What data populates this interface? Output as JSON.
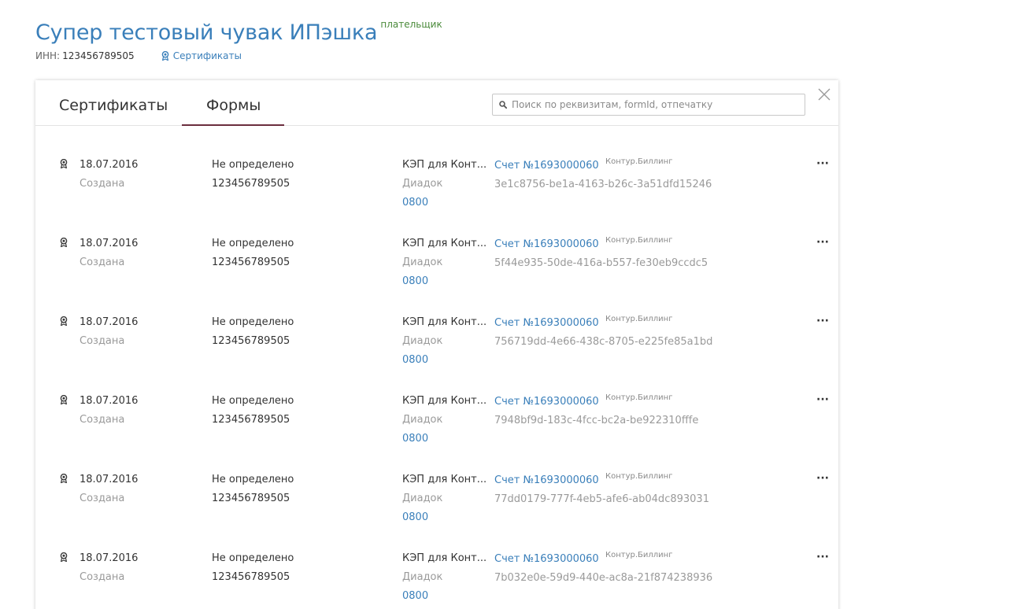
{
  "header": {
    "title": "Супер тестовый чувак ИПэшка",
    "badge": "плательщик",
    "inn_label": "ИНН:",
    "inn_value": "123456789505",
    "certificates_link": "Сертификаты"
  },
  "tabs": [
    {
      "label": "Сертификаты",
      "active": false
    },
    {
      "label": "Формы",
      "active": true
    }
  ],
  "search": {
    "placeholder": "Поиск по реквизитам, formId, отпечатку",
    "value": ""
  },
  "colors": {
    "accent": "#3a7fba",
    "badge": "#4a8a3a",
    "tab_underline": "#6b2e3e",
    "muted": "#9a9a9a"
  },
  "rows": [
    {
      "date": "18.07.2016",
      "status": "Создана",
      "kind": "Не определено",
      "inn": "123456789505",
      "product": "КЭП для Конт...",
      "source": "Диадок",
      "code": "0800",
      "invoice": "Счет №1693000060",
      "billing": "Контур.Биллинг",
      "guid": "3e1c8756-be1a-4163-b26c-3a51dfd15246"
    },
    {
      "date": "18.07.2016",
      "status": "Создана",
      "kind": "Не определено",
      "inn": "123456789505",
      "product": "КЭП для Конт...",
      "source": "Диадок",
      "code": "0800",
      "invoice": "Счет №1693000060",
      "billing": "Контур.Биллинг",
      "guid": "5f44e935-50de-416a-b557-fe30eb9ccdc5"
    },
    {
      "date": "18.07.2016",
      "status": "Создана",
      "kind": "Не определено",
      "inn": "123456789505",
      "product": "КЭП для Конт...",
      "source": "Диадок",
      "code": "0800",
      "invoice": "Счет №1693000060",
      "billing": "Контур.Биллинг",
      "guid": "756719dd-4e66-438c-8705-e225fe85a1bd"
    },
    {
      "date": "18.07.2016",
      "status": "Создана",
      "kind": "Не определено",
      "inn": "123456789505",
      "product": "КЭП для Конт...",
      "source": "Диадок",
      "code": "0800",
      "invoice": "Счет №1693000060",
      "billing": "Контур.Биллинг",
      "guid": "7948bf9d-183c-4fcc-bc2a-be922310fffe"
    },
    {
      "date": "18.07.2016",
      "status": "Создана",
      "kind": "Не определено",
      "inn": "123456789505",
      "product": "КЭП для Конт...",
      "source": "Диадок",
      "code": "0800",
      "invoice": "Счет №1693000060",
      "billing": "Контур.Биллинг",
      "guid": "77dd0179-777f-4eb5-afe6-ab04dc893031"
    },
    {
      "date": "18.07.2016",
      "status": "Создана",
      "kind": "Не определено",
      "inn": "123456789505",
      "product": "КЭП для Конт...",
      "source": "Диадок",
      "code": "0800",
      "invoice": "Счет №1693000060",
      "billing": "Контур.Биллинг",
      "guid": "7b032e0e-59d9-440e-ac8a-21f874238936"
    }
  ],
  "row_menu_glyph": "···"
}
